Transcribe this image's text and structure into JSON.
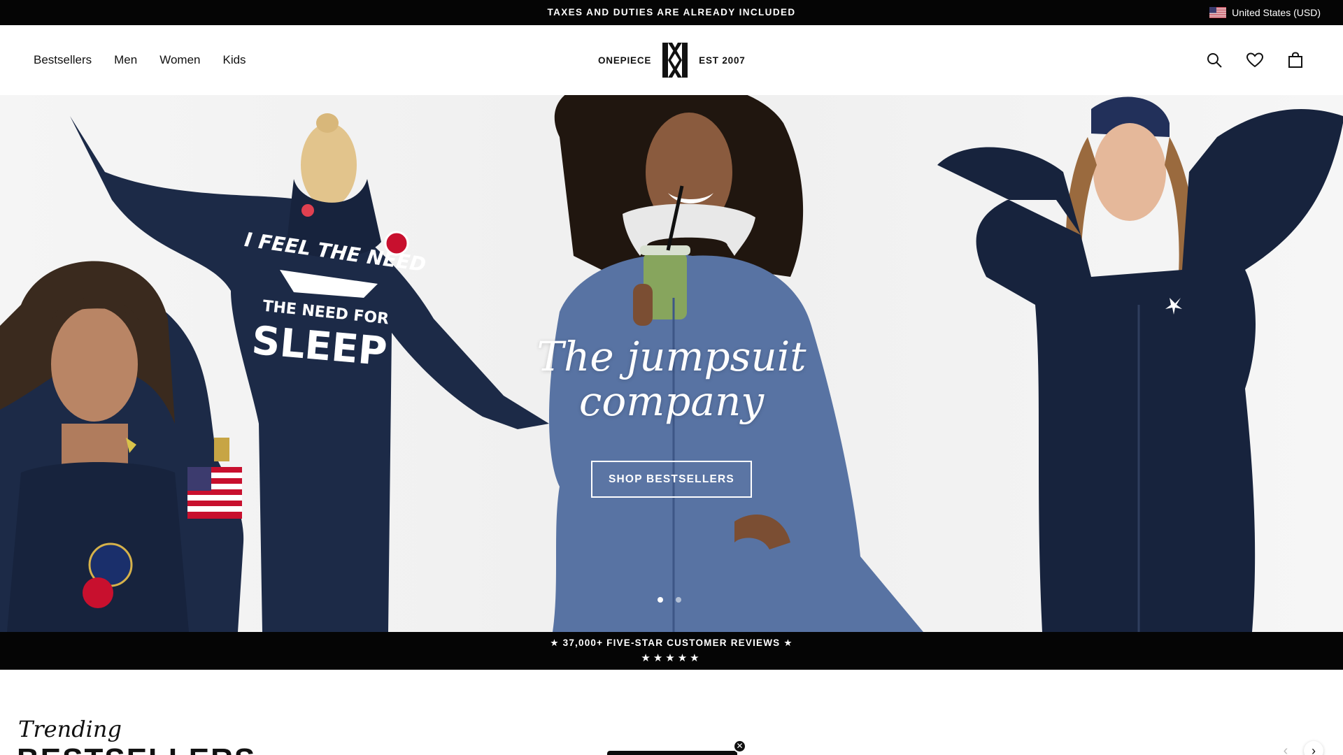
{
  "announcement": {
    "text": "TAXES AND DUTIES ARE ALREADY INCLUDED",
    "locale": "United States (USD)",
    "flag_icon": "us-flag-icon"
  },
  "header": {
    "nav": [
      "Bestsellers",
      "Men",
      "Women",
      "Kids"
    ],
    "logo": {
      "left": "ONEPIECE",
      "right": "EST 2007"
    },
    "icons": [
      "search-icon",
      "heart-icon",
      "bag-icon"
    ]
  },
  "hero": {
    "title_line1": "The jumpsuit",
    "title_line2": "company",
    "cta": "SHOP BESTSELLERS",
    "slide_count": 2,
    "active_slide": 1,
    "print_text": [
      "I FEEL THE NEED",
      "THE NEED FOR",
      "SLEEP"
    ]
  },
  "reviews": {
    "text": "★ 37,000+ FIVE-STAR CUSTOMER REVIEWS ★",
    "stars": "★★★★★"
  },
  "trending": {
    "script": "Trending",
    "heading": "BESTSELLERS"
  },
  "colors": {
    "black": "#050505",
    "white": "#ffffff",
    "navy": "#17233d",
    "denim": "#5873a3",
    "hero_bg": "#f1f1f1"
  }
}
